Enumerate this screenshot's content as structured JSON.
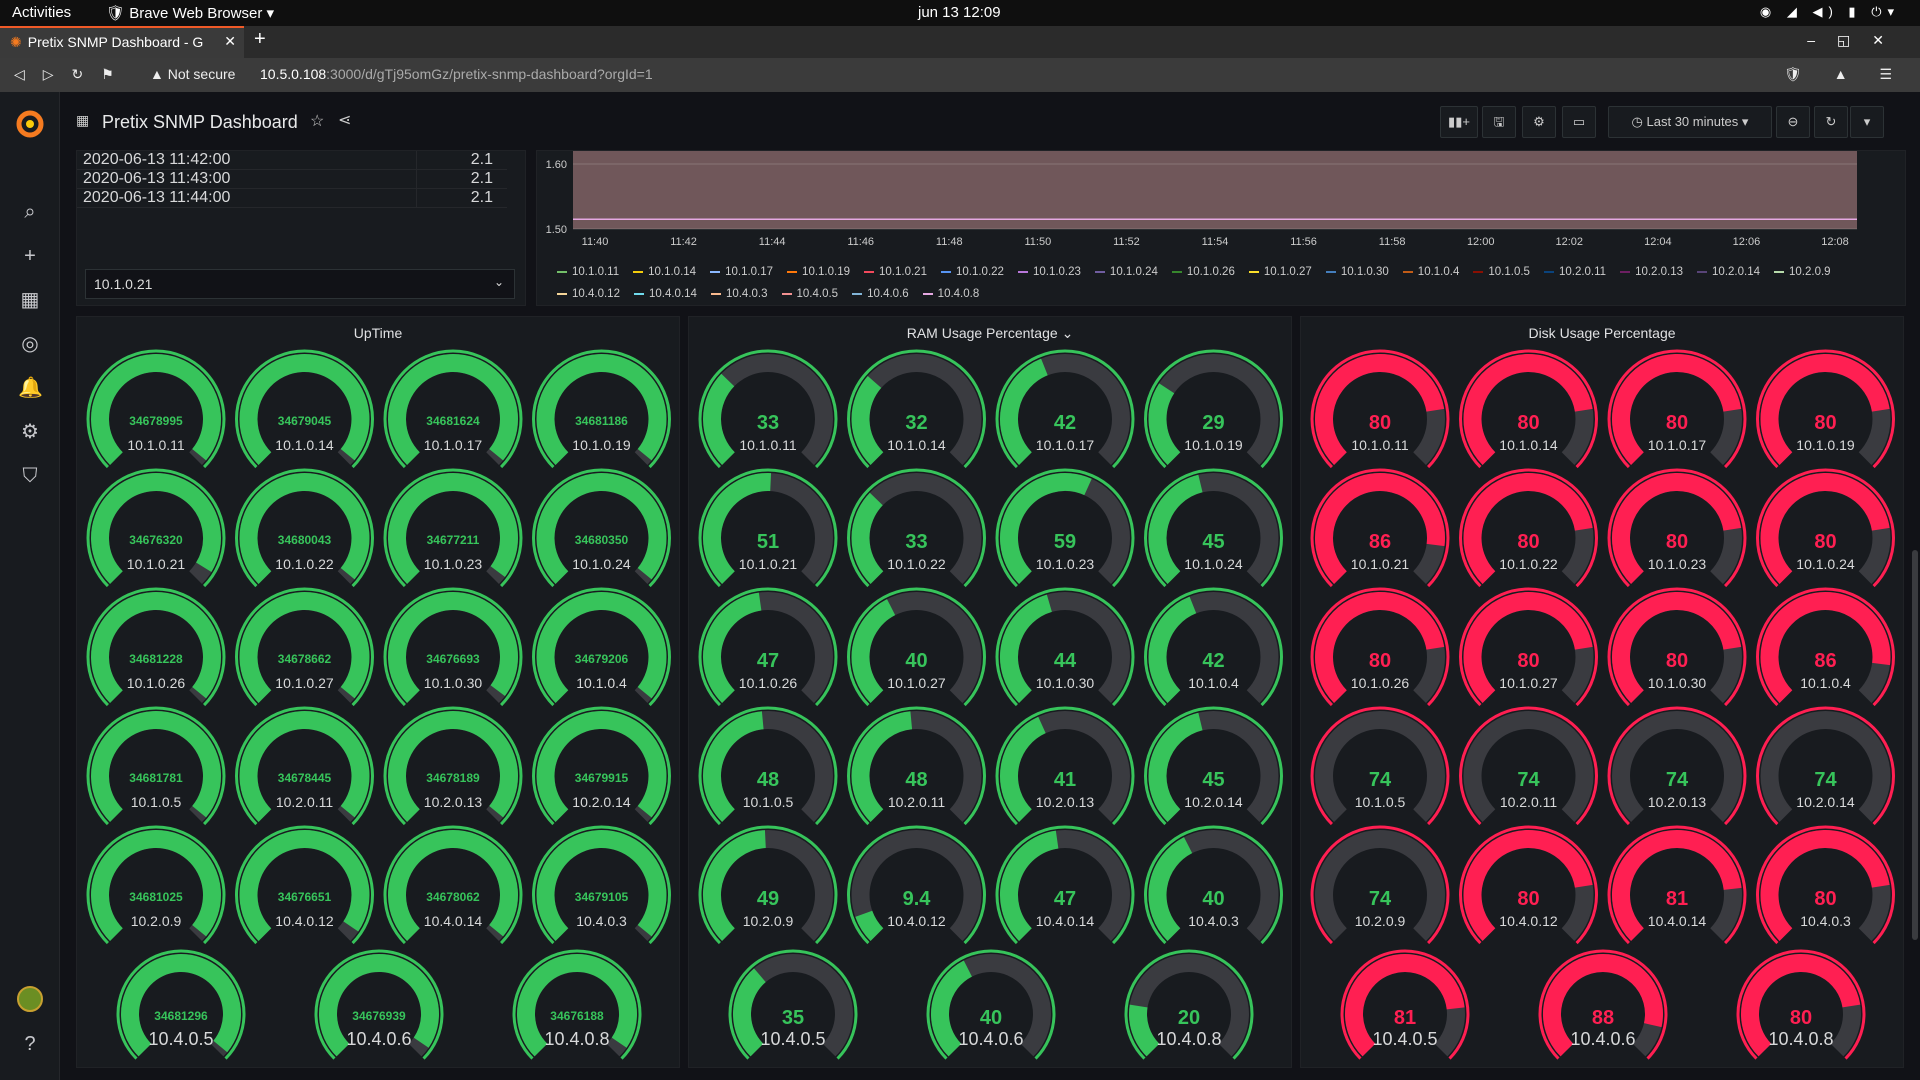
{
  "system": {
    "activities": "Activities",
    "app_name": "Brave Web Browser",
    "clock": "jun 13  12:09"
  },
  "browser": {
    "tab_title": "Pretix SNMP Dashboard - G",
    "security": "Not secure",
    "url_host": "10.5.0.108",
    "url_path": ":3000/d/gTj95omGz/pretix-snmp-dashboard?orgId=1"
  },
  "dashboard": {
    "title": "Pretix SNMP Dashboard",
    "time_range": "Last 30 minutes"
  },
  "table": {
    "rows": [
      {
        "time": "2020-06-13 11:42:00",
        "value": "2.1"
      },
      {
        "time": "2020-06-13 11:43:00",
        "value": "2.1"
      },
      {
        "time": "2020-06-13 11:44:00",
        "value": "2.1"
      }
    ],
    "selected_host": "10.1.0.21"
  },
  "chart_data": {
    "type": "line",
    "title": "",
    "xlabel": "",
    "ylabel": "",
    "y_ticks": [
      "1.60",
      "1.50"
    ],
    "ylim": [
      1.5,
      1.62
    ],
    "x_ticks": [
      "11:40",
      "11:42",
      "11:44",
      "11:46",
      "11:48",
      "11:50",
      "11:52",
      "11:54",
      "11:56",
      "11:58",
      "12:00",
      "12:02",
      "12:04",
      "12:06",
      "12:08"
    ],
    "series": [
      {
        "name": "10.1.0.11",
        "color": "#73bf69"
      },
      {
        "name": "10.1.0.14",
        "color": "#f2cc0c"
      },
      {
        "name": "10.1.0.17",
        "color": "#8ab8ff"
      },
      {
        "name": "10.1.0.19",
        "color": "#ff780a"
      },
      {
        "name": "10.1.0.21",
        "color": "#f2495c"
      },
      {
        "name": "10.1.0.22",
        "color": "#5794f2"
      },
      {
        "name": "10.1.0.23",
        "color": "#b877d9"
      },
      {
        "name": "10.1.0.24",
        "color": "#705da0"
      },
      {
        "name": "10.1.0.26",
        "color": "#37872d"
      },
      {
        "name": "10.1.0.27",
        "color": "#fade2a"
      },
      {
        "name": "10.1.0.30",
        "color": "#447ebc"
      },
      {
        "name": "10.1.0.4",
        "color": "#c15c17"
      },
      {
        "name": "10.1.0.5",
        "color": "#890f02"
      },
      {
        "name": "10.2.0.11",
        "color": "#0a437c"
      },
      {
        "name": "10.2.0.13",
        "color": "#6d1f62"
      },
      {
        "name": "10.2.0.14",
        "color": "#584477"
      },
      {
        "name": "10.2.0.9",
        "color": "#b7dbab"
      },
      {
        "name": "10.4.0.12",
        "color": "#f4d598"
      },
      {
        "name": "10.4.0.14",
        "color": "#70dbed"
      },
      {
        "name": "10.4.0.3",
        "color": "#f9ba8f"
      },
      {
        "name": "10.4.0.5",
        "color": "#f29191"
      },
      {
        "name": "10.4.0.6",
        "color": "#82b5d8"
      },
      {
        "name": "10.4.0.8",
        "color": "#e5a8e2"
      }
    ]
  },
  "colors": {
    "green": "#37c45b",
    "red": "#ff1f52",
    "track": "#3a3b40"
  },
  "hosts": [
    "10.1.0.11",
    "10.1.0.14",
    "10.1.0.17",
    "10.1.0.19",
    "10.1.0.21",
    "10.1.0.22",
    "10.1.0.23",
    "10.1.0.24",
    "10.1.0.26",
    "10.1.0.27",
    "10.1.0.30",
    "10.1.0.4",
    "10.1.0.5",
    "10.2.0.11",
    "10.2.0.13",
    "10.2.0.14",
    "10.2.0.9",
    "10.4.0.12",
    "10.4.0.14",
    "10.4.0.3",
    "10.4.0.5",
    "10.4.0.6",
    "10.4.0.8"
  ],
  "panels": [
    {
      "title": "UpTime",
      "id": "uptime",
      "unit_max": null,
      "values": [
        "34678995",
        "34679045",
        "34681624",
        "34681186",
        "34676320",
        "34680043",
        "34677211",
        "34680350",
        "34681228",
        "34678662",
        "34676693",
        "34679206",
        "34681781",
        "34678445",
        "34678189",
        "34679915",
        "34681025",
        "34676651",
        "34678062",
        "34679105",
        "34681296",
        "34676939",
        "34676188"
      ],
      "fill": [
        0.98,
        0.98,
        0.98,
        0.98,
        0.95,
        0.98,
        0.97,
        0.98,
        0.98,
        0.98,
        0.97,
        0.98,
        0.98,
        0.98,
        0.98,
        0.98,
        0.98,
        0.96,
        0.98,
        0.98,
        0.98,
        0.96,
        0.96
      ],
      "colors": [
        "green",
        "green",
        "green",
        "green",
        "green",
        "green",
        "green",
        "green",
        "green",
        "green",
        "green",
        "green",
        "green",
        "green",
        "green",
        "green",
        "green",
        "green",
        "green",
        "green",
        "green",
        "green",
        "green"
      ]
    },
    {
      "title": "RAM Usage Percentage",
      "id": "ram",
      "values": [
        "33",
        "32",
        "42",
        "29",
        "51",
        "33",
        "59",
        "45",
        "47",
        "40",
        "44",
        "42",
        "48",
        "48",
        "41",
        "45",
        "49",
        "9.4",
        "47",
        "40",
        "35",
        "40",
        "20"
      ],
      "fill": [
        0.33,
        0.32,
        0.42,
        0.29,
        0.51,
        0.33,
        0.59,
        0.45,
        0.47,
        0.4,
        0.44,
        0.42,
        0.48,
        0.48,
        0.41,
        0.45,
        0.49,
        0.094,
        0.47,
        0.4,
        0.35,
        0.4,
        0.2
      ],
      "colors": [
        "green",
        "green",
        "green",
        "green",
        "green",
        "green",
        "green",
        "green",
        "green",
        "green",
        "green",
        "green",
        "green",
        "green",
        "green",
        "green",
        "green",
        "green",
        "green",
        "green",
        "green",
        "green",
        "green"
      ]
    },
    {
      "title": "Disk Usage Percentage",
      "id": "disk",
      "values": [
        "80",
        "80",
        "80",
        "80",
        "86",
        "80",
        "80",
        "80",
        "80",
        "80",
        "80",
        "86",
        "74",
        "74",
        "74",
        "74",
        "74",
        "80",
        "81",
        "80",
        "81",
        "88",
        "80"
      ],
      "fill": [
        0.8,
        0.8,
        0.8,
        0.8,
        0.86,
        0.8,
        0.8,
        0.8,
        0.8,
        0.8,
        0.8,
        0.86,
        0.74,
        0.74,
        0.74,
        0.74,
        0.74,
        0.8,
        0.81,
        0.8,
        0.81,
        0.88,
        0.8
      ],
      "colors": [
        "red",
        "red",
        "red",
        "red",
        "red",
        "red",
        "red",
        "red",
        "red",
        "red",
        "red",
        "red",
        "track",
        "track",
        "track",
        "track",
        "track",
        "red",
        "red",
        "red",
        "red",
        "red",
        "red"
      ]
    }
  ]
}
